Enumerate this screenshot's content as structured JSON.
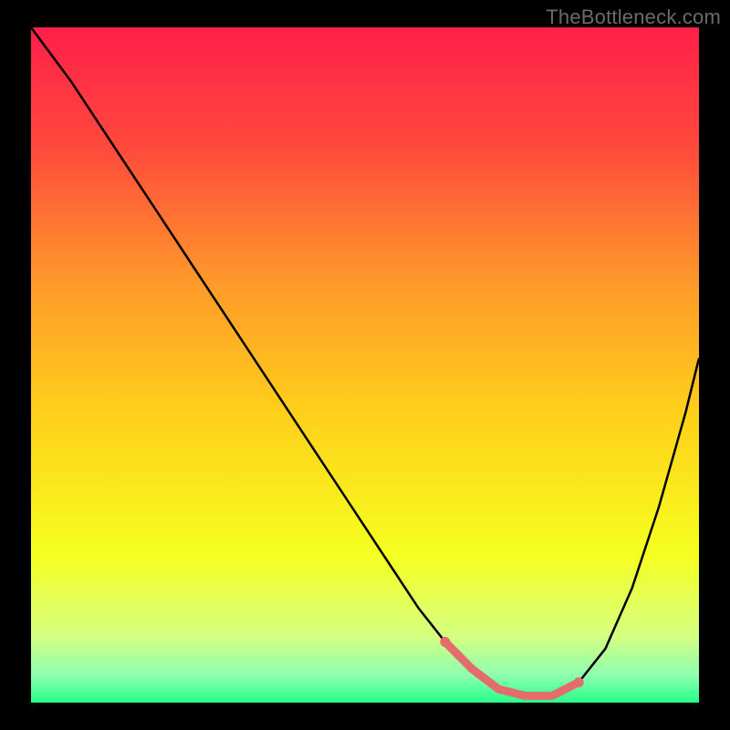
{
  "watermark": "TheBottleneck.com",
  "chart_data": {
    "type": "line",
    "title": "",
    "xlabel": "",
    "ylabel": "",
    "xlim": [
      0,
      100
    ],
    "ylim": [
      0,
      100
    ],
    "background_gradient": {
      "direction": "vertical",
      "stops": [
        {
          "pos": 0.0,
          "color": "#ff1f4a"
        },
        {
          "pos": 0.18,
          "color": "#ff4a3c"
        },
        {
          "pos": 0.38,
          "color": "#ff9a2a"
        },
        {
          "pos": 0.58,
          "color": "#ffd21a"
        },
        {
          "pos": 0.78,
          "color": "#f5ff20"
        },
        {
          "pos": 0.9,
          "color": "#d6ff80"
        },
        {
          "pos": 0.96,
          "color": "#8dffb0"
        },
        {
          "pos": 1.0,
          "color": "#26ff88"
        }
      ]
    },
    "series": [
      {
        "name": "bottleneck-curve",
        "color": "#000000",
        "stroke_width": 2.5,
        "x": [
          0,
          6,
          12,
          18,
          24,
          30,
          36,
          42,
          48,
          54,
          58,
          62,
          66,
          70,
          74,
          78,
          82,
          86,
          90,
          94,
          98,
          100
        ],
        "y": [
          100,
          92,
          83,
          74,
          65,
          56,
          47,
          38,
          29,
          20,
          14,
          9,
          5,
          2,
          1,
          1,
          3,
          8,
          17,
          29,
          43,
          51
        ]
      }
    ],
    "highlight": {
      "name": "optimal-region",
      "color": "#e46c6c",
      "stroke_width": 9,
      "x": [
        62,
        66,
        70,
        74,
        78,
        82
      ],
      "y": [
        9,
        5,
        2,
        1,
        1,
        3
      ]
    }
  }
}
